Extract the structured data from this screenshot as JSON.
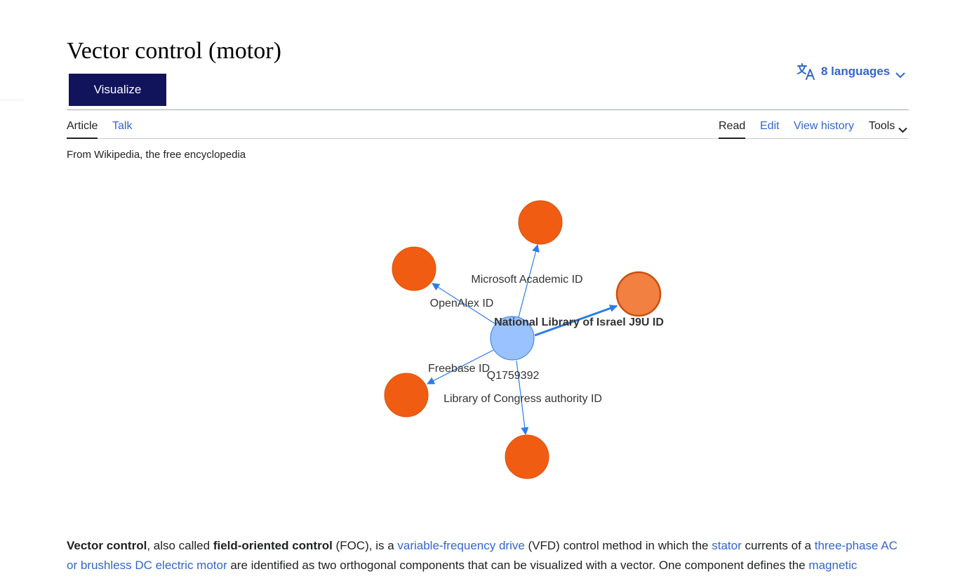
{
  "page": {
    "title": "Vector control (motor)",
    "tagline": "From Wikipedia, the free encyclopedia"
  },
  "visualize_button": {
    "label": "Visualize"
  },
  "languages": {
    "label": "8 languages",
    "icon": "translate-icon"
  },
  "tabs": {
    "left": [
      {
        "label": "Article",
        "active": true
      },
      {
        "label": "Talk",
        "active": false
      }
    ],
    "right": [
      {
        "label": "Read",
        "active": true
      },
      {
        "label": "Edit",
        "active": false
      },
      {
        "label": "View history",
        "active": false
      },
      {
        "label": "Tools",
        "active": false
      }
    ]
  },
  "graph": {
    "center": {
      "label": "Q1759392",
      "color": "#99c2ff"
    },
    "node_color": "#f05d12",
    "highlight_color": "#f28040",
    "edge_color": "#2b7ce9",
    "edges": [
      {
        "label": "Microsoft Academic ID"
      },
      {
        "label": "OpenAlex ID"
      },
      {
        "label": "National Library of Israel J9U ID",
        "highlighted": true
      },
      {
        "label": "Freebase ID"
      },
      {
        "label": "Library of Congress authority ID"
      }
    ]
  },
  "body": {
    "intro": [
      {
        "text": "Vector control",
        "style": "bold"
      },
      {
        "text": ", also called ",
        "style": "plain"
      },
      {
        "text": "field-oriented control",
        "style": "bold"
      },
      {
        "text": " (FOC), is a ",
        "style": "plain"
      },
      {
        "text": "variable-frequency drive",
        "style": "link"
      },
      {
        "text": " (VFD) control method in which the ",
        "style": "plain"
      },
      {
        "text": "stator",
        "style": "link"
      },
      {
        "text": " currents of a ",
        "style": "plain"
      },
      {
        "text": "three-phase AC or brushless DC electric motor",
        "style": "link"
      },
      {
        "text": " are identified as two orthogonal components that can be visualized with a vector. One component defines the ",
        "style": "plain"
      },
      {
        "text": "magnetic",
        "style": "link"
      }
    ]
  },
  "colors": {
    "link": "#3366cc",
    "visualize_bg": "#11135b",
    "text": "#202122"
  }
}
